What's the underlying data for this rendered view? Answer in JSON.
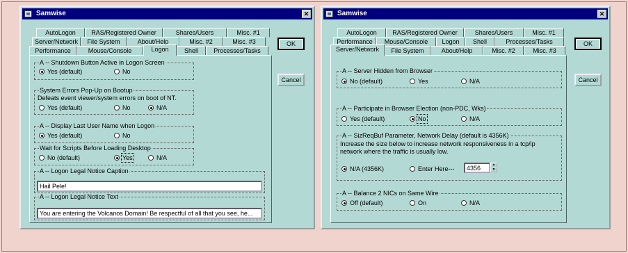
{
  "left": {
    "title": "Samwise",
    "tabs_row1": [
      "AutoLogon",
      "RAS/Registered Owner",
      "Shares/Users",
      "Misc. #1"
    ],
    "tabs_row2": [
      "Server/Network",
      "File System",
      "About/Help",
      "Misc. #2",
      "Misc. #3"
    ],
    "tabs_row3": [
      "Performance",
      "Mouse/Console",
      "Logon",
      "Shell",
      "Processes/Tasks"
    ],
    "ok": "OK",
    "cancel": "Cancel",
    "g1": {
      "title": "A -- Shutdown Button Active in Logon Screen",
      "opt1": "Yes (default)",
      "opt2": "No"
    },
    "g2": {
      "title": "System Errors Pop-Up on Bootup",
      "desc": "Defeats event viewer/system errors on boot of NT.",
      "opt1": "Yes (default)",
      "opt2": "No",
      "opt3": "N/A"
    },
    "g3": {
      "title": "A -- Display Last User Name when Logon",
      "opt1": "Yes (default)",
      "opt2": "No"
    },
    "g4": {
      "title": "Wait for Scripts Before Loading Desktop",
      "opt1": "No (default)",
      "opt2": "Yes",
      "opt3": "N/A"
    },
    "g5": {
      "title": "A -- Logon Legal Notice Caption",
      "value": "Hail Pele!"
    },
    "g6": {
      "title": "A -- Logon Legal Notice Text",
      "value": "You are entering the Volcanos Domain! Be respectful of all that you see, he..."
    }
  },
  "right": {
    "title": "Samwise",
    "tabs_row1": [
      "AutoLogon",
      "RAS/Registered Owner",
      "Shares/Users",
      "Misc. #1"
    ],
    "tabs_row2": [
      "Performance",
      "Mouse/Console",
      "Logon",
      "Shell",
      "Processes/Tasks"
    ],
    "tabs_row3": [
      "Server/Network",
      "File System",
      "About/Help",
      "Misc. #2",
      "Misc. #3"
    ],
    "ok": "OK",
    "cancel": "Cancel",
    "g1": {
      "title": "A -- Server Hidden from Browser",
      "opt1": "No (default)",
      "opt2": "Yes",
      "opt3": "N/A"
    },
    "g2": {
      "title": "A -- Participate in Browser Election (non-PDC, Wks)",
      "opt1": "Yes (default)",
      "opt2": "No",
      "opt3": "N/A"
    },
    "g3": {
      "title": "A -- SizReqBuf Parameter, Network Delay (default is 4356K)",
      "desc1": "Increase the size below to increase network responsiveness in a tcp/ip",
      "desc2": "network where the traffic is usually low.",
      "opt1": "N/A  (4356K)",
      "opt2": "Enter Here---",
      "value": "4356"
    },
    "g4": {
      "title": "A -- Balance 2 NICs on Same Wire",
      "opt1": "Off (default)",
      "opt2": "On",
      "opt3": "N/A"
    }
  }
}
